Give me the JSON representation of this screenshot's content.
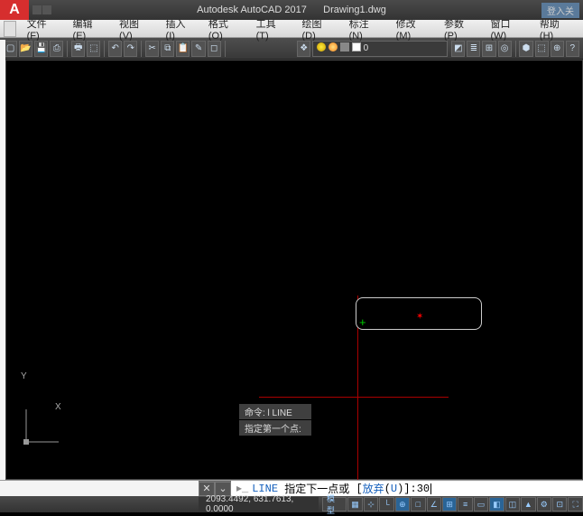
{
  "title": {
    "app": "Autodesk AutoCAD 2017",
    "doc": "Drawing1.dwg",
    "login_hint": "登入关"
  },
  "menu": {
    "file": "文件(F)",
    "edit": "编辑(E)",
    "view": "视图(V)",
    "insert": "插入(I)",
    "format": "格式(O)",
    "tools": "工具(T)",
    "draw": "绘图(D)",
    "dimension": "标注(N)",
    "modify": "修改(M)",
    "param": "参数(P)",
    "window": "窗口(W)",
    "help": "帮助(H)"
  },
  "layer": {
    "current": "0"
  },
  "ucs": {
    "x": "X",
    "y": "Y"
  },
  "command_history": {
    "line1": "命令: l  LINE",
    "line2": "指定第一个点:"
  },
  "command_line": {
    "prefix": "LINE",
    "prompt_a": "指定下一点或",
    "opt_label": "放弃",
    "opt_key": "U",
    "suffix": ": ",
    "value": "30"
  },
  "status": {
    "coords": "2093.4492, 631.7613, 0.0000",
    "model": "模型",
    "grid": "▦",
    "snap": "⊹",
    "ortho": "└",
    "polar": "⊕",
    "osnap": "□",
    "otrack": "∠",
    "dyn": "⊞",
    "lwt": "≡",
    "trans": "▭",
    "qp": "◧",
    "sc": "◫",
    "ann": "▲",
    "ws": "⚙",
    "am": "⊡",
    "full": "⛶"
  }
}
